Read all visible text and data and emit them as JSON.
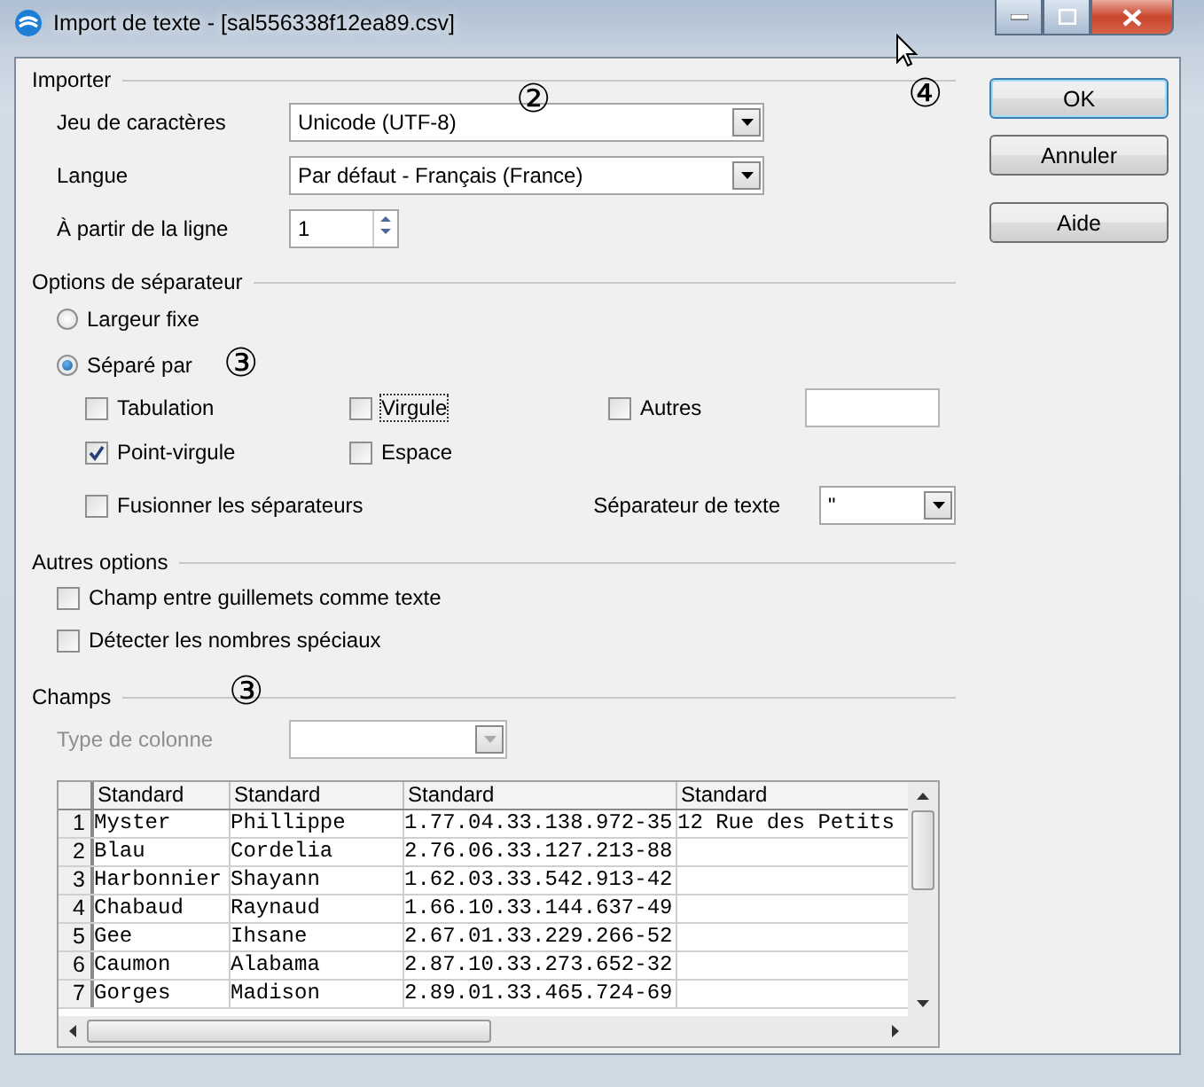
{
  "window": {
    "title": "Import de texte - [sal556338f12ea89.csv]"
  },
  "importer": {
    "title": "Importer",
    "marker": "②",
    "charset": {
      "label": "Jeu de caractères",
      "value": "Unicode (UTF-8)"
    },
    "language": {
      "label": "Langue",
      "value": "Par défaut - Français (France)"
    },
    "from_line": {
      "label": "À partir de la ligne",
      "value": "1"
    }
  },
  "separator_options": {
    "title": "Options de séparateur",
    "marker": "③",
    "modes": [
      {
        "label": "Largeur fixe",
        "selected": false
      },
      {
        "label": "Séparé par",
        "selected": true
      }
    ],
    "separators": [
      {
        "label": "Tabulation",
        "checked": false,
        "focused": false
      },
      {
        "label": "Virgule",
        "checked": false,
        "focused": true
      },
      {
        "label": "Autres",
        "checked": false,
        "focused": false
      },
      {
        "label": "Point-virgule",
        "checked": true,
        "focused": false
      },
      {
        "label": "Espace",
        "checked": false,
        "focused": false
      }
    ],
    "merge": {
      "label": "Fusionner les séparateurs",
      "checked": false
    },
    "text_separator": {
      "label": "Séparateur de texte",
      "value": "\""
    }
  },
  "other_options": {
    "title": "Autres options",
    "options": [
      {
        "label": "Champ entre guillemets comme texte",
        "checked": false
      },
      {
        "label": "Détecter les nombres spéciaux",
        "checked": false
      }
    ]
  },
  "fields": {
    "title": "Champs",
    "marker": "③",
    "column_type": {
      "label": "Type de colonne",
      "disabled": true
    },
    "table": {
      "columns": [
        "Standard",
        "Standard",
        "Standard",
        "Standard"
      ],
      "rows": [
        {
          "number": "1",
          "cells": [
            "Myster",
            "Phillippe",
            "1.77.04.33.138.972-35",
            "12 Rue des Petits"
          ]
        },
        {
          "number": "2",
          "cells": [
            "Blau",
            "Cordelia",
            "2.76.06.33.127.213-88",
            ""
          ]
        },
        {
          "number": "3",
          "cells": [
            "Harbonnier",
            "Shayann",
            "1.62.03.33.542.913-42",
            ""
          ]
        },
        {
          "number": "4",
          "cells": [
            "Chabaud",
            "Raynaud",
            "1.66.10.33.144.637-49",
            ""
          ]
        },
        {
          "number": "5",
          "cells": [
            "Gee",
            "Ihsane",
            "2.67.01.33.229.266-52",
            ""
          ]
        },
        {
          "number": "6",
          "cells": [
            "Caumon",
            "Alabama",
            "2.87.10.33.273.652-32",
            ""
          ]
        },
        {
          "number": "7",
          "cells": [
            "Gorges",
            "Madison",
            "2.89.01.33.465.724-69",
            ""
          ]
        }
      ]
    }
  },
  "buttons_marker": "④",
  "buttons": [
    {
      "label": "OK",
      "default": true
    },
    {
      "label": "Annuler",
      "default": false
    },
    {
      "label": "Aide",
      "default": false
    }
  ]
}
